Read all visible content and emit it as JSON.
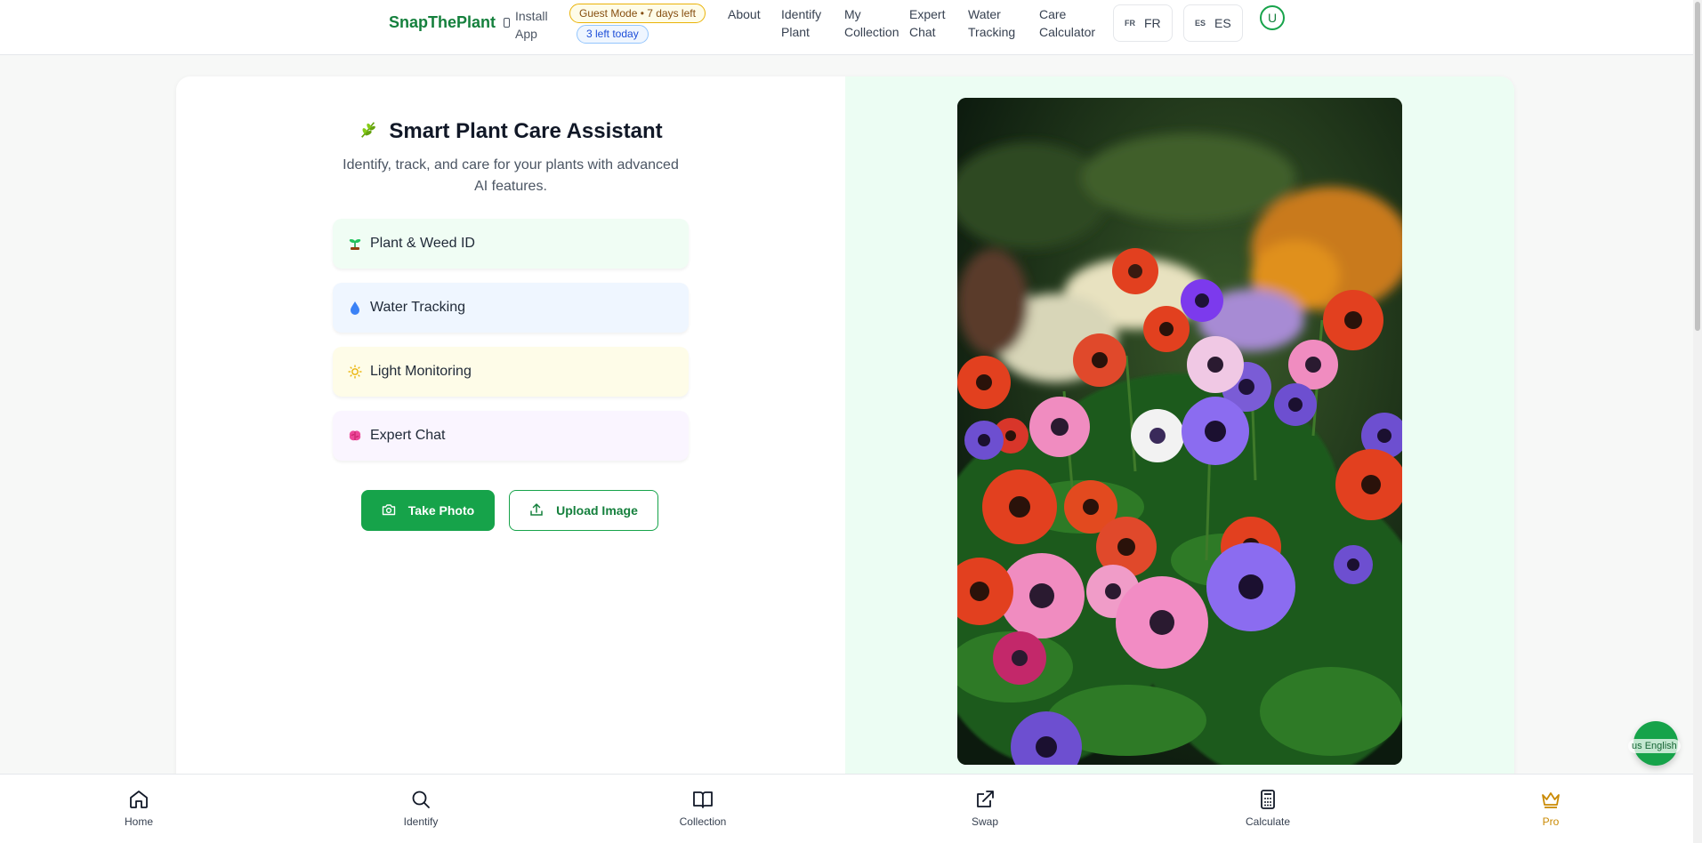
{
  "header": {
    "brand": "SnapThePlant",
    "install_label": "Install App",
    "guest_badge": "Guest Mode • 7 days left",
    "left_badge": "3 left today",
    "nav": [
      {
        "label": "About"
      },
      {
        "label": "Identify Plant"
      },
      {
        "label": "My Collection"
      },
      {
        "label": "Expert Chat"
      },
      {
        "label": "Water Tracking"
      },
      {
        "label": "Care Calculator"
      }
    ],
    "lang_fr": {
      "code": "FR",
      "label": "FR"
    },
    "lang_es": {
      "code": "ES",
      "label": "ES"
    },
    "avatar": "U"
  },
  "hero": {
    "title": "Smart Plant Care Assistant",
    "subtitle": "Identify, track, and care for your plants with advanced AI features.",
    "features": [
      {
        "label": "Plant & Weed ID",
        "icon": "seedling-icon",
        "bg": "#f0fdf4"
      },
      {
        "label": "Water Tracking",
        "icon": "droplet-icon",
        "bg": "#eff6ff"
      },
      {
        "label": "Light Monitoring",
        "icon": "sun-icon",
        "bg": "#fefce8"
      },
      {
        "label": "Expert Chat",
        "icon": "brain-icon",
        "bg": "#faf5ff"
      }
    ],
    "take_photo": "Take Photo",
    "upload_image": "Upload Image"
  },
  "bottom_nav": [
    {
      "label": "Home",
      "icon": "home-icon"
    },
    {
      "label": "Identify",
      "icon": "search-icon"
    },
    {
      "label": "Collection",
      "icon": "book-icon"
    },
    {
      "label": "Swap",
      "icon": "external-link-icon"
    },
    {
      "label": "Calculate",
      "icon": "calculator-icon"
    },
    {
      "label": "Pro",
      "icon": "crown-icon"
    }
  ],
  "floating_lang": {
    "code": "us",
    "label": "English"
  },
  "colors": {
    "brand": "#15803d",
    "primary": "#16a34a",
    "pro": "#ca8a04"
  }
}
